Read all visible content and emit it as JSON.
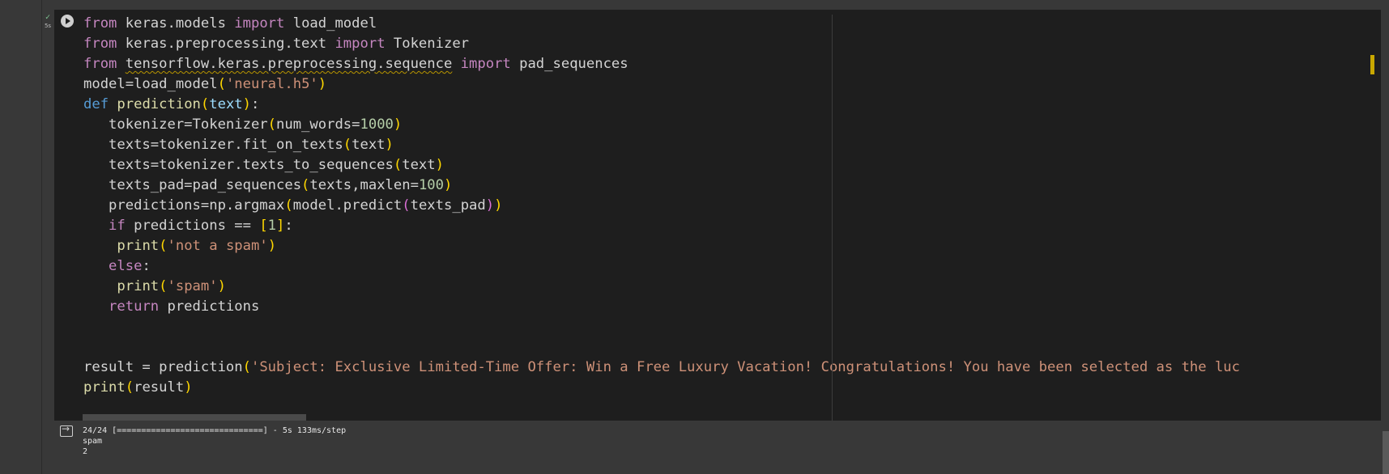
{
  "cell_status": {
    "check": "✓",
    "duration": "5s"
  },
  "code_lines": [
    [
      [
        "from ",
        "kw"
      ],
      [
        "keras.models ",
        ""
      ],
      [
        "import ",
        "kw"
      ],
      [
        "load_model",
        ""
      ]
    ],
    [
      [
        "from ",
        "kw"
      ],
      [
        "keras.preprocessing.text ",
        ""
      ],
      [
        "import ",
        "kw"
      ],
      [
        "Tokenizer",
        ""
      ]
    ],
    [
      [
        "from ",
        "kw"
      ],
      [
        "tensorflow.keras.preprocessing.sequence",
        "squig"
      ],
      [
        " ",
        ""
      ],
      [
        "import ",
        "kw"
      ],
      [
        "pad_sequences",
        ""
      ]
    ],
    [
      [
        "model=load_model",
        ""
      ],
      [
        "(",
        "b1"
      ],
      [
        "'neural.h5'",
        "str"
      ],
      [
        ")",
        "b1"
      ]
    ],
    [
      [
        "def ",
        "def"
      ],
      [
        "prediction",
        "fn"
      ],
      [
        "(",
        "b1"
      ],
      [
        "text",
        "param"
      ],
      [
        ")",
        "b1"
      ],
      [
        ":",
        ""
      ]
    ],
    [
      [
        "   tokenizer=Tokenizer",
        ""
      ],
      [
        "(",
        "b1"
      ],
      [
        "num_words=",
        ""
      ],
      [
        "1000",
        "num"
      ],
      [
        ")",
        "b1"
      ]
    ],
    [
      [
        "   texts=tokenizer.fit_on_texts",
        ""
      ],
      [
        "(",
        "b1"
      ],
      [
        "text",
        ""
      ],
      [
        ")",
        "b1"
      ]
    ],
    [
      [
        "   texts=tokenizer.texts_to_sequences",
        ""
      ],
      [
        "(",
        "b1"
      ],
      [
        "text",
        ""
      ],
      [
        ")",
        "b1"
      ]
    ],
    [
      [
        "   texts_pad=pad_sequences",
        ""
      ],
      [
        "(",
        "b1"
      ],
      [
        "texts,maxlen=",
        ""
      ],
      [
        "100",
        "num"
      ],
      [
        ")",
        "b1"
      ]
    ],
    [
      [
        "   predictions=np.argmax",
        ""
      ],
      [
        "(",
        "b1"
      ],
      [
        "model.predict",
        ""
      ],
      [
        "(",
        "b2"
      ],
      [
        "texts_pad",
        ""
      ],
      [
        ")",
        "b2"
      ],
      [
        ")",
        "b1"
      ]
    ],
    [
      [
        "   ",
        ""
      ],
      [
        "if ",
        "kw"
      ],
      [
        "predictions == ",
        ""
      ],
      [
        "[",
        "b1"
      ],
      [
        "1",
        "num"
      ],
      [
        "]",
        "b1"
      ],
      [
        ":",
        ""
      ]
    ],
    [
      [
        "    ",
        ""
      ],
      [
        "print",
        "fn"
      ],
      [
        "(",
        "b1"
      ],
      [
        "'not a spam'",
        "str"
      ],
      [
        ")",
        "b1"
      ]
    ],
    [
      [
        "   ",
        ""
      ],
      [
        "else",
        "kw"
      ],
      [
        ":",
        ""
      ]
    ],
    [
      [
        "    ",
        ""
      ],
      [
        "print",
        "fn"
      ],
      [
        "(",
        "b1"
      ],
      [
        "'spam'",
        "str"
      ],
      [
        ")",
        "b1"
      ]
    ],
    [
      [
        "   ",
        ""
      ],
      [
        "return ",
        "kw"
      ],
      [
        "predictions",
        ""
      ]
    ],
    [],
    [],
    [
      [
        "result = prediction",
        ""
      ],
      [
        "(",
        "b1"
      ],
      [
        "'Subject: Exclusive Limited-Time Offer: Win a Free Luxury Vacation! Congratulations! You have been selected as the luc",
        "str"
      ]
    ],
    [
      [
        "print",
        "fn"
      ],
      [
        "(",
        "b1"
      ],
      [
        "result",
        ""
      ],
      [
        ")",
        "b1"
      ]
    ]
  ],
  "output": {
    "progress": "24/24 [==============================] - 5s 133ms/step",
    "line1": "spam",
    "line2": "2"
  }
}
